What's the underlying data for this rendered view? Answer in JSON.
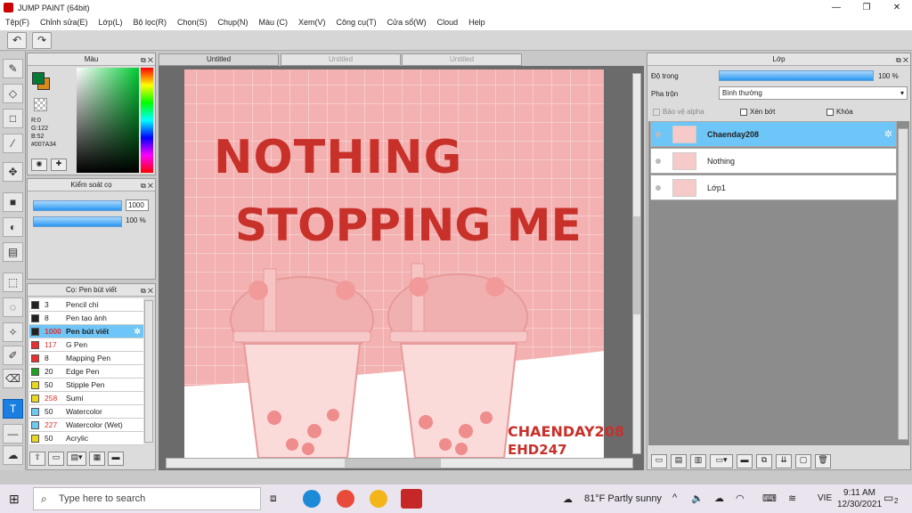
{
  "window": {
    "title": "JUMP PAINT (64bit)",
    "minimize": "—",
    "maximize": "❐",
    "close": "✕"
  },
  "menu": [
    "Tệp(F)",
    "Chỉnh sửa(E)",
    "Lớp(L)",
    "Bộ lọc(R)",
    "Chọn(S)",
    "Chụp(N)",
    "Màu (C)",
    "Xem(V)",
    "Công cụ(T)",
    "Cửa sổ(W)",
    "Cloud",
    "Help"
  ],
  "toolbar": {
    "undo": "↶",
    "redo": "↷"
  },
  "tabs": [
    "Untitled",
    "Untitled",
    "Untitled"
  ],
  "color_panel": {
    "title": "Màu",
    "r": "R:0",
    "g": "G:122",
    "b": "B:52",
    "hex": "#007A34",
    "fg": "#007A34",
    "bg": "#d98a1a"
  },
  "brush_control": {
    "title": "Kiểm soát cọ",
    "size": "1000",
    "opacity": "100 %"
  },
  "brush_panel": {
    "title": "Cọ: Pen bút viết",
    "items": [
      {
        "size": "3",
        "name": "Pencil chì",
        "color": "#222222",
        "size_color": "#222"
      },
      {
        "size": "8",
        "name": "Pen tạo ảnh",
        "color": "#222222",
        "size_color": "#222"
      },
      {
        "size": "1000",
        "name": "Pen bút viết",
        "color": "#222222",
        "size_color": "#e03030",
        "selected": true
      },
      {
        "size": "117",
        "name": "G Pen",
        "color": "#e83030",
        "size_color": "#e03030"
      },
      {
        "size": "8",
        "name": "Mapping Pen",
        "color": "#e83030",
        "size_color": "#222"
      },
      {
        "size": "20",
        "name": "Edge Pen",
        "color": "#22a022",
        "size_color": "#222"
      },
      {
        "size": "50",
        "name": "Stipple Pen",
        "color": "#e8d820",
        "size_color": "#222"
      },
      {
        "size": "258",
        "name": "Sumi",
        "color": "#e8d820",
        "size_color": "#e03030"
      },
      {
        "size": "50",
        "name": "Watercolor",
        "color": "#6ec8f0",
        "size_color": "#222"
      },
      {
        "size": "227",
        "name": "Watercolor (Wet)",
        "color": "#6ec8f0",
        "size_color": "#e03030"
      },
      {
        "size": "50",
        "name": "Acrylic",
        "color": "#e8d820",
        "size_color": "#222"
      }
    ]
  },
  "artwork": {
    "line1": "NOTHING",
    "line2": "STOPPING ME",
    "sig1": "CHAENDAY208",
    "sig2": "EHD247"
  },
  "layer_panel": {
    "title": "Lớp",
    "opacity_label": "Độ trong",
    "opacity_value": "100 %",
    "blend_label": "Pha trộn",
    "blend_value": "Bình thường",
    "protect_alpha": "Bảo vệ alpha",
    "clip": "Xén bớt",
    "lock": "Khóa",
    "layers": [
      {
        "name": "Chaenday208",
        "selected": true
      },
      {
        "name": "Nothing",
        "selected": false
      },
      {
        "name": "Lớp1",
        "selected": false
      }
    ]
  },
  "taskbar": {
    "search_placeholder": "Type here to search",
    "weather": "81°F  Partly sunny",
    "lang": "VIE",
    "time": "9:11 AM",
    "date": "12/30/2021",
    "notif": "2"
  }
}
